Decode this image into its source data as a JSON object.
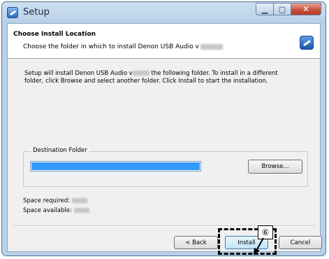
{
  "window": {
    "title": "Setup"
  },
  "header": {
    "title": "Choose Install Location",
    "subtitle": "Choose the folder in which to install Denon USB Audio v"
  },
  "description": {
    "line1_a": "Setup will install Denon USB Audio v",
    "line1_b": " the following folder. To install in a different",
    "line2": "folder, click Browse and select another folder. Click Install to start the installation."
  },
  "destination": {
    "legend": "Destination Folder",
    "browse_label": "Browse..."
  },
  "space": {
    "required_label": "Space required:",
    "available_label": "Space available:"
  },
  "buttons": {
    "back": "< Back",
    "install": "Install",
    "cancel": "Cancel"
  },
  "annotation": {
    "step": "⑥"
  },
  "colors": {
    "selection": "#3399ff",
    "titlebar": "#b9d1ea",
    "close": "#c44f38"
  }
}
